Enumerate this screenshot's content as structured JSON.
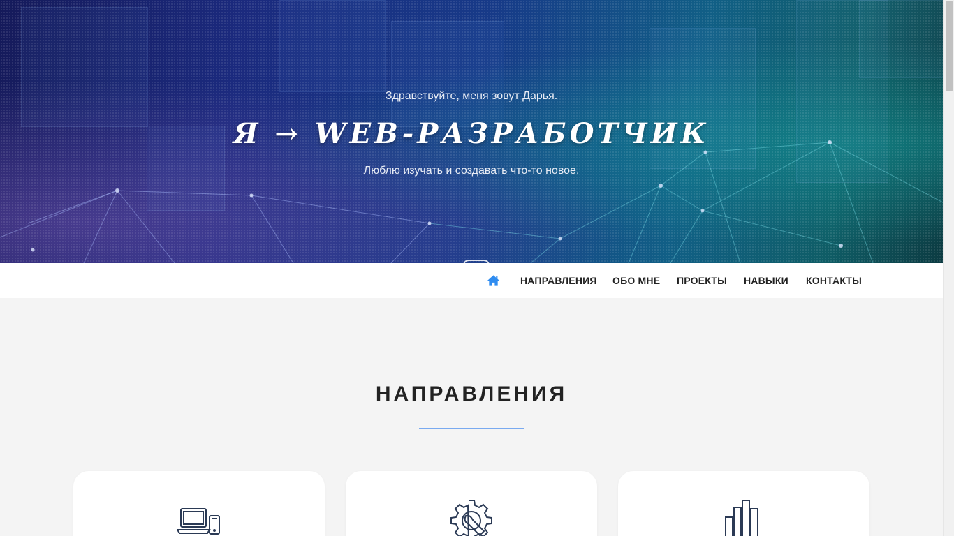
{
  "hero": {
    "greeting": "Здравствуйте, меня зовут Дарья.",
    "title": "Я → WEB-РАЗРАБОТЧИК",
    "subtitle": "Люблю изучать и создавать что-то новое."
  },
  "nav": {
    "home_icon": "home-icon",
    "items": [
      "НАПРАВЛЕНИЯ",
      "ОБО МНЕ",
      "ПРОЕКТЫ",
      "НАВЫКИ",
      "КОНТАКТЫ"
    ],
    "accent": "#2f8cf0"
  },
  "section": {
    "title": "НАПРАВЛЕНИЯ",
    "line_color": "#7aaaf0"
  },
  "cards": [
    {
      "icon": "devices-icon"
    },
    {
      "icon": "settings-wrench-icon"
    },
    {
      "icon": "bar-chart-icon"
    }
  ],
  "colors": {
    "page_bg": "#f4f4f4",
    "icon_stroke": "#2b3a55",
    "text_dark": "#222222"
  }
}
